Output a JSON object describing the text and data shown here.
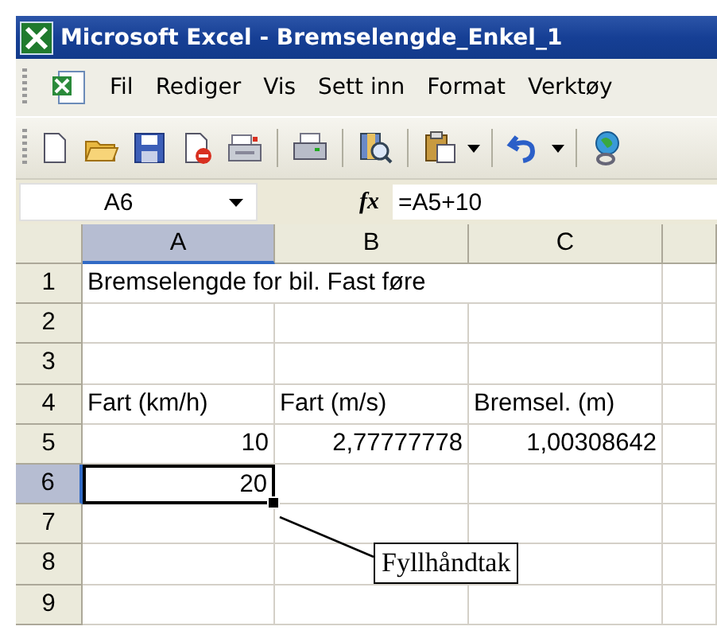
{
  "window": {
    "title": "Microsoft Excel - Bremselengde_Enkel_1"
  },
  "menu": [
    "Fil",
    "Rediger",
    "Vis",
    "Sett inn",
    "Format",
    "Verktøy"
  ],
  "formula_bar": {
    "name_box": "A6",
    "function_label": "fx",
    "formula": "=A5+10"
  },
  "sheet": {
    "columns": [
      {
        "label": "A",
        "selected": true
      },
      {
        "label": "B",
        "selected": false
      },
      {
        "label": "C",
        "selected": false
      }
    ],
    "rows": [
      {
        "label": "1",
        "selected": false,
        "cells": [
          {
            "text": "Bremselengde for bil. Fast føre",
            "kind": "text",
            "selected": false
          },
          null,
          null
        ]
      },
      {
        "label": "2",
        "selected": false,
        "cells": [
          null,
          null,
          null
        ]
      },
      {
        "label": "3",
        "selected": false,
        "cells": [
          null,
          null,
          null
        ]
      },
      {
        "label": "4",
        "selected": false,
        "cells": [
          {
            "text": "Fart (km/h)",
            "kind": "text",
            "selected": false
          },
          {
            "text": "Fart (m/s)",
            "kind": "text",
            "selected": false
          },
          {
            "text": "Bremsel. (m)",
            "kind": "text",
            "selected": false
          }
        ]
      },
      {
        "label": "5",
        "selected": false,
        "cells": [
          {
            "text": "10",
            "kind": "number",
            "selected": false
          },
          {
            "text": "2,77777778",
            "kind": "number",
            "selected": false
          },
          {
            "text": "1,00308642",
            "kind": "number",
            "selected": false
          }
        ]
      },
      {
        "label": "6",
        "selected": true,
        "cells": [
          {
            "text": "20",
            "kind": "number",
            "selected": true
          },
          null,
          null
        ]
      },
      {
        "label": "7",
        "selected": false,
        "cells": [
          null,
          null,
          null
        ]
      },
      {
        "label": "8",
        "selected": false,
        "cells": [
          null,
          null,
          null
        ]
      },
      {
        "label": "9",
        "selected": false,
        "cells": [
          null,
          null,
          null
        ]
      }
    ]
  },
  "callout": {
    "text": "Fyllhåndtak"
  }
}
